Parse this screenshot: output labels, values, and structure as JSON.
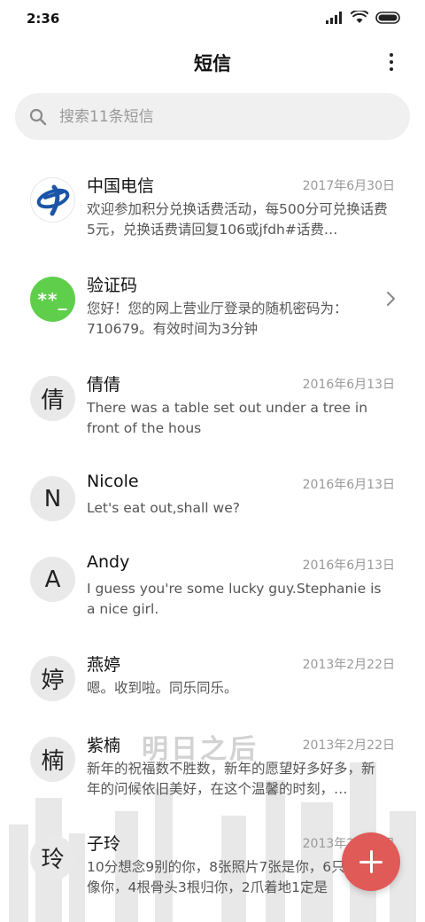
{
  "status_bar": {
    "time": "2:36",
    "icons": [
      "signal-icon",
      "wifi-icon",
      "battery-icon"
    ]
  },
  "header": {
    "title": "短信",
    "more_icon": "more-vertical-icon"
  },
  "search": {
    "placeholder": "搜索11条短信",
    "icon": "search-icon"
  },
  "conversations": [
    {
      "name": "中国电信",
      "date": "2017年6月30日",
      "preview": "欢迎参加积分兑换话费活动，每500分可兑换话费5元，兑换话费请回复106或jfdh#话费…",
      "avatar": "china-telecom-logo"
    },
    {
      "name": "验证码",
      "date": "",
      "preview": "您好！您的网上营业厅登录的随机密码为：710679。有效时间为3分钟",
      "avatar_text": "**_"
    },
    {
      "name": "倩倩",
      "date": "2016年6月13日",
      "preview": "There was a table set out under a tree in front of the hous",
      "avatar_text": "倩"
    },
    {
      "name": "Nicole",
      "date": "2016年6月13日",
      "preview": "Let's eat out,shall we?",
      "avatar_text": "N"
    },
    {
      "name": "Andy",
      "date": "2016年6月13日",
      "preview": "I guess you're some lucky guy.Stephanie is a nice girl.",
      "avatar_text": "A"
    },
    {
      "name": "燕婷",
      "date": "2013年2月22日",
      "preview": "嗯。收到啦。同乐同乐。",
      "avatar_text": "婷"
    },
    {
      "name": "紫楠",
      "date": "2013年2月22日",
      "preview": "新年的祝福数不胜数，新年的愿望好多好多，新年的问候依旧美好，在这个温馨的时刻，…",
      "avatar_text": "楠"
    },
    {
      "name": "子玲",
      "date": "2013年2月22日",
      "preview": "10分想念9别的你，8张照片7张是你，6只… 5只像你，4根骨头3根归你，2爪着地1定是",
      "avatar_text": "玲"
    }
  ],
  "watermark": {
    "text": "明日之后"
  },
  "fab": {
    "icon": "plus-icon",
    "color": "#e05a57"
  },
  "colors": {
    "accent_fab": "#e05a57",
    "verify_avatar": "#5fcf4b",
    "telecom_blue": "#1a55a8"
  }
}
